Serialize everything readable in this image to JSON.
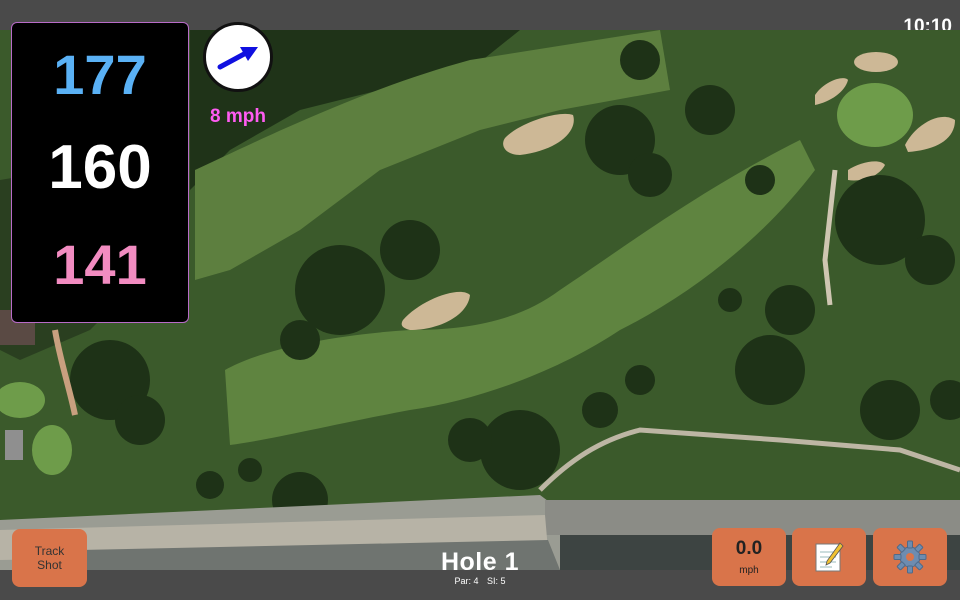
{
  "clock": "10:10",
  "distances": {
    "back": {
      "value": "177",
      "color": "#5ab1f5"
    },
    "middle": {
      "value": "160",
      "color": "#ffffff"
    },
    "front": {
      "value": "141",
      "color": "#f28cc1"
    }
  },
  "wind": {
    "speed": "8 mph",
    "icon": "wind-arrow-icon"
  },
  "buttons": {
    "track_shot": "Track\nShot",
    "speed_value": "0.0",
    "speed_unit": "mph",
    "notes_icon": "notepad-icon",
    "settings_icon": "gear-icon"
  },
  "hole": {
    "title": "Hole 1",
    "par": "Par: 4",
    "si": "SI: 5"
  },
  "colors": {
    "accent": "#d9744a",
    "wind_text": "#ff5cf2",
    "panel_border": "#b86bc8"
  }
}
